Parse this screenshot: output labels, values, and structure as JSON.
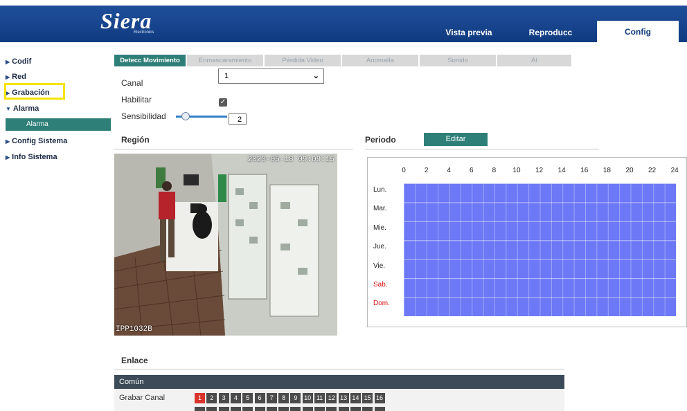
{
  "header": {
    "brand": "Siera",
    "brand_sub": "Electronics",
    "nav": [
      "Vista previa",
      "Reproducc",
      "Config"
    ],
    "active_nav": "Config"
  },
  "sidebar": {
    "items": [
      {
        "label": "Codif",
        "expanded": false
      },
      {
        "label": "Red",
        "expanded": false
      },
      {
        "label": "Grabación",
        "expanded": false
      },
      {
        "label": "Alarma",
        "expanded": true
      },
      {
        "label": "Config Sistema",
        "expanded": false
      },
      {
        "label": "Info Sistema",
        "expanded": false
      }
    ],
    "sub_item": "Alarma"
  },
  "tabs": [
    "Detecc Movimiento",
    "Enmascaramiento",
    "Pérdida Video",
    "Anomalía",
    "Sonido",
    "AI"
  ],
  "active_tab": "Detecc Movimiento",
  "form": {
    "canal_label": "Canal",
    "canal_value": "1",
    "habilitar_label": "Habilitar",
    "habilitar_checked": true,
    "sensibilidad_label": "Sensibilidad",
    "sensibilidad_value": "2"
  },
  "region": {
    "title": "Región",
    "timestamp": "2023-05-18 09:09:15",
    "camera_name": "IPP1032B"
  },
  "periodo": {
    "title": "Periodo",
    "edit_label": "Editar",
    "hours": [
      "0",
      "2",
      "4",
      "6",
      "8",
      "10",
      "12",
      "14",
      "16",
      "18",
      "20",
      "22",
      "24"
    ],
    "days": [
      "Lun.",
      "Mar.",
      "Mie.",
      "Jue.",
      "Vie.",
      "Sab.",
      "Dom."
    ],
    "weekend_color": "#d11111",
    "fill_color": "#6c78f6",
    "coverage_fraction": 1.0
  },
  "enlace": {
    "title": "Enlace",
    "common_label": "Común",
    "grabar_label": "Grabar Canal",
    "channels": [
      "1",
      "2",
      "3",
      "4",
      "5",
      "6",
      "7",
      "8",
      "9",
      "10",
      "11",
      "12",
      "13",
      "14",
      "15",
      "16"
    ],
    "selected_channel": "1"
  }
}
